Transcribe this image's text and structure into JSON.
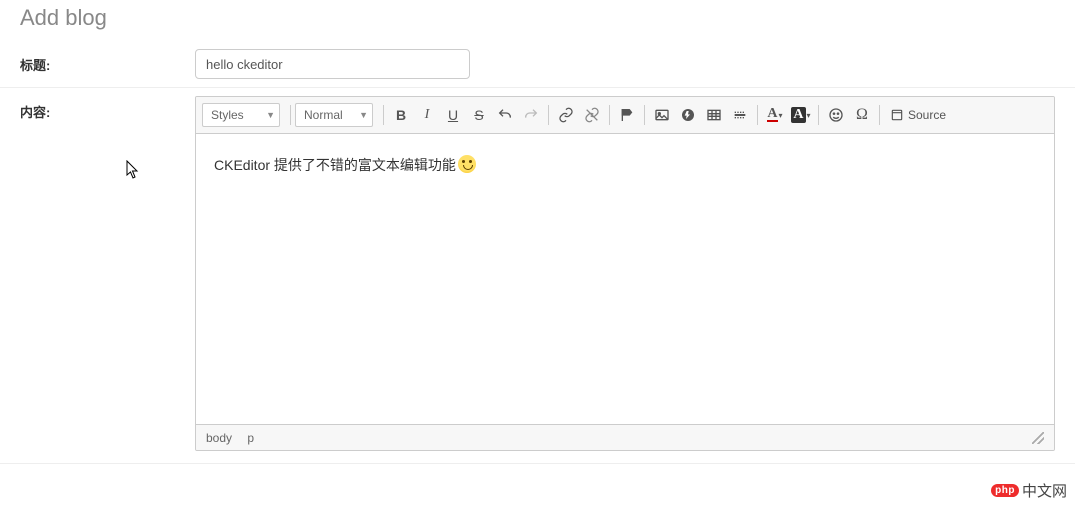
{
  "page": {
    "title": "Add blog"
  },
  "form": {
    "title_label": "标题:",
    "title_value": "hello ckeditor",
    "content_label": "内容:"
  },
  "toolbar": {
    "styles": "Styles",
    "format": "Normal",
    "source": "Source"
  },
  "editor": {
    "content_text": "CKEditor 提供了不错的富文本编辑功能"
  },
  "statusbar": {
    "path": [
      "body",
      "p"
    ]
  },
  "watermark": {
    "badge": "php",
    "text": "中文网"
  }
}
